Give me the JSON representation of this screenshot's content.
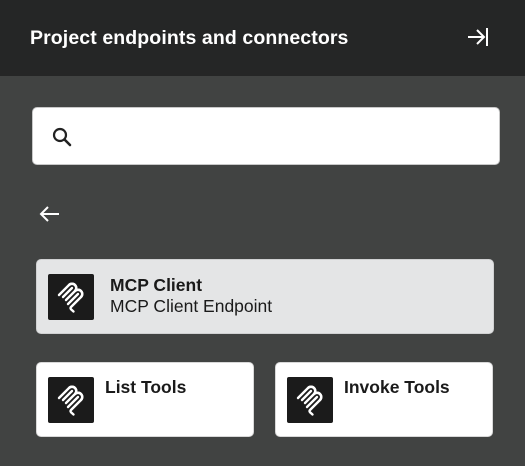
{
  "header": {
    "title": "Project endpoints and connectors",
    "collapse_icon": "collapse-right-icon"
  },
  "search": {
    "value": "",
    "placeholder": "",
    "icon": "search-icon"
  },
  "nav": {
    "back_icon": "arrow-left-icon"
  },
  "selected": {
    "title": "MCP Client",
    "subtitle": "MCP Client Endpoint",
    "icon": "mcp-logo-icon"
  },
  "items": [
    {
      "title": "List Tools",
      "icon": "mcp-logo-icon"
    },
    {
      "title": "Invoke Tools",
      "icon": "mcp-logo-icon"
    }
  ],
  "colors": {
    "header_bg": "#252626",
    "panel_bg": "#414342",
    "selected_card_bg": "#e4e5e6",
    "card_bg": "#ffffff",
    "logo_bg": "#1b1b1b"
  }
}
